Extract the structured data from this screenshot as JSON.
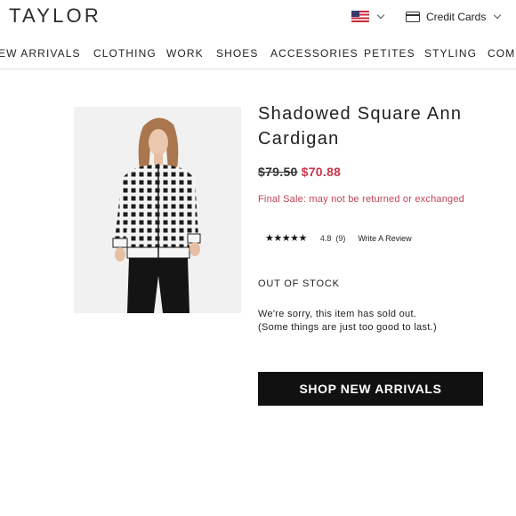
{
  "header": {
    "logo": "TAYLOR",
    "country_flag_icon": "us-flag-icon",
    "credit_cards_label": "Credit Cards"
  },
  "nav": {
    "items": [
      "EW ARRIVALS",
      "CLOTHING",
      "WORK",
      "SHOES",
      "ACCESSORIES",
      "PETITES",
      "STYLING",
      "COM"
    ]
  },
  "product": {
    "title": "Shadowed Square Ann Cardigan",
    "original_price": "$79.50",
    "sale_price": "$70.88",
    "final_sale_note": "Final Sale: may not be returned or exchanged",
    "stars": "★★★★★",
    "rating": "4.8",
    "review_count": "(9)",
    "write_review_label": "Write A Review",
    "stock_status": "OUT OF STOCK",
    "sold_out_line1": "We're sorry, this item has sold out.",
    "sold_out_line2": "(Some things are just too good to last.)",
    "cta_label": "SHOP NEW ARRIVALS"
  },
  "colors": {
    "sale_red": "#c8374a",
    "button_black": "#111111"
  }
}
